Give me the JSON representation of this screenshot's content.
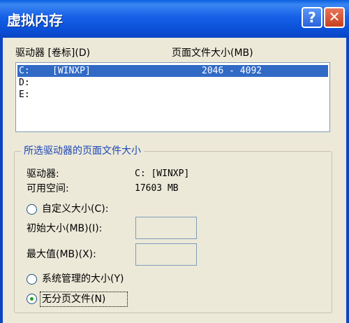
{
  "window": {
    "title": "虚拟内存",
    "help_button": "?",
    "close_button": "✕"
  },
  "drive_list": {
    "header_drive": "驱动器 [卷标](D)",
    "header_size": "页面文件大小(MB)",
    "rows": [
      {
        "drive": "C:",
        "label": "[WINXP]",
        "size": "2046 - 4092",
        "selected": true
      },
      {
        "drive": "D:",
        "label": "",
        "size": "",
        "selected": false
      },
      {
        "drive": "E:",
        "label": "",
        "size": "",
        "selected": false
      }
    ]
  },
  "selected_drive_group": {
    "title": "所选驱动器的页面文件大小",
    "drive_label": "驱动器:",
    "drive_value": "C:  [WINXP]",
    "space_label": "可用空间:",
    "space_value": "17603 MB",
    "custom_size_label": "自定义大小(C):",
    "initial_size_label": "初始大小(MB)(I):",
    "initial_size_value": "",
    "max_size_label": "最大值(MB)(X):",
    "max_size_value": "",
    "system_managed_label": "系统管理的大小(Y)",
    "no_paging_label": "无分页文件(N)",
    "selected_option": "no_paging"
  }
}
